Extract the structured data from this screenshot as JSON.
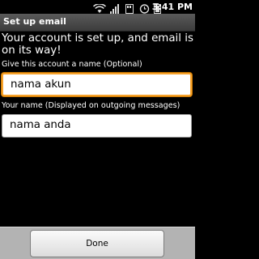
{
  "status_bar": {
    "time": "3:41 PM",
    "icons": [
      "wifi-icon",
      "signal-icon",
      "storage-icon",
      "alarm-icon",
      "battery-icon"
    ]
  },
  "title_bar": {
    "title": "Set up email"
  },
  "message": "Your account is set up, and email is on its way!",
  "account_name": {
    "label": "Give this account a name (Optional)",
    "value": "nama akun"
  },
  "your_name": {
    "label": "Your name (Displayed on outgoing messages)",
    "value": "nama anda"
  },
  "done_button": {
    "label": "Done"
  },
  "colors": {
    "focus_border": "#f7a22a",
    "title_bar": "#4a4a4a",
    "bottom_bar": "#b3b3b3"
  }
}
